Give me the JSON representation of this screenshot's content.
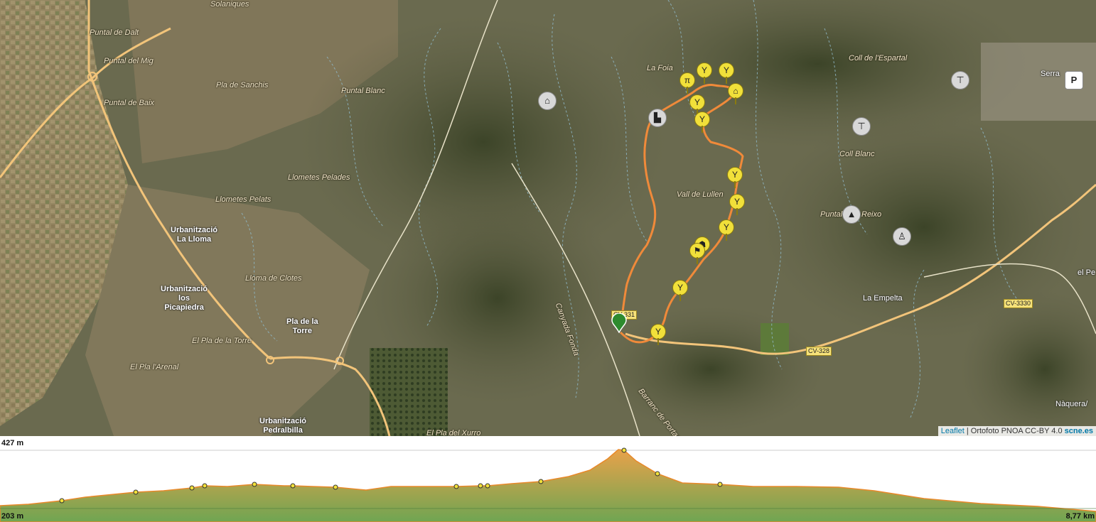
{
  "map": {
    "place_labels": {
      "solaniques": "Solaniques",
      "puntal_dalt": "Puntal de Dalt",
      "puntal_mig": "Puntal del Mig",
      "pla_sanchis": "Pla de Sanchis",
      "puntal_baix": "Puntal de Baix",
      "puntal_blanc": "Puntal Blanc",
      "llometes_pelades": "Llometes Pelades",
      "llometes_pelats": "Llometes Pelats",
      "loma_clotes": "Lloma de Clotes",
      "pla_torre_italic": "El Pla de la Torre",
      "pla_arenal": "El Pla l'Arenal",
      "pla_xurro": "El Pla del Xurro",
      "la_foia": "La Foia",
      "coll_espartal": "Coll de l'Espartal",
      "coll_blanc": "Coll Blanc",
      "vall_lullen": "Vall de Lullen",
      "puntal_reixo_a": "Puntal",
      "puntal_reixo_b": "Reixo",
      "canyada": "Canyada Fonda",
      "barranc": "Barranc de Portaceli"
    },
    "towns": {
      "lloma_1": "Urbanització",
      "lloma_2": "La Lloma",
      "picapiedra_1": "Urbanització",
      "picapiedra_2": "los",
      "picapiedra_3": "Picapiedra",
      "pla_torre_1": "Pla de la",
      "pla_torre_2": "Torre",
      "pedralbilla_1": "Urbanització",
      "pedralbilla_2": "Pedralbilla",
      "serra": "Serra",
      "empelta": "La Empelta",
      "naquera": "Nàquera/",
      "el_pe": "el Pe"
    },
    "road_tags": {
      "cv3330": "CV-3330",
      "cv328": "CV-328",
      "cv331": "CV-331"
    },
    "poi_icons": [
      "cave-icon",
      "factory-icon",
      "water-tap-icon",
      "water-tap-icon",
      "peak-icon",
      "monument-icon",
      "parking-icon"
    ],
    "route_color": "#f08a3a",
    "waypoint_color": "#f1e03a",
    "start_color": "#2e8b2e",
    "attribution": {
      "leaflet": "Leaflet",
      "separator": " | Ortofoto PNOA CC-BY 4.0 ",
      "brand": "scne.es"
    }
  },
  "profile": {
    "max_elevation": "427 m",
    "min_elevation": "203 m",
    "distance": "8,77 km",
    "fill_top": "#e8a24a",
    "fill_bottom": "#6fa552"
  }
}
